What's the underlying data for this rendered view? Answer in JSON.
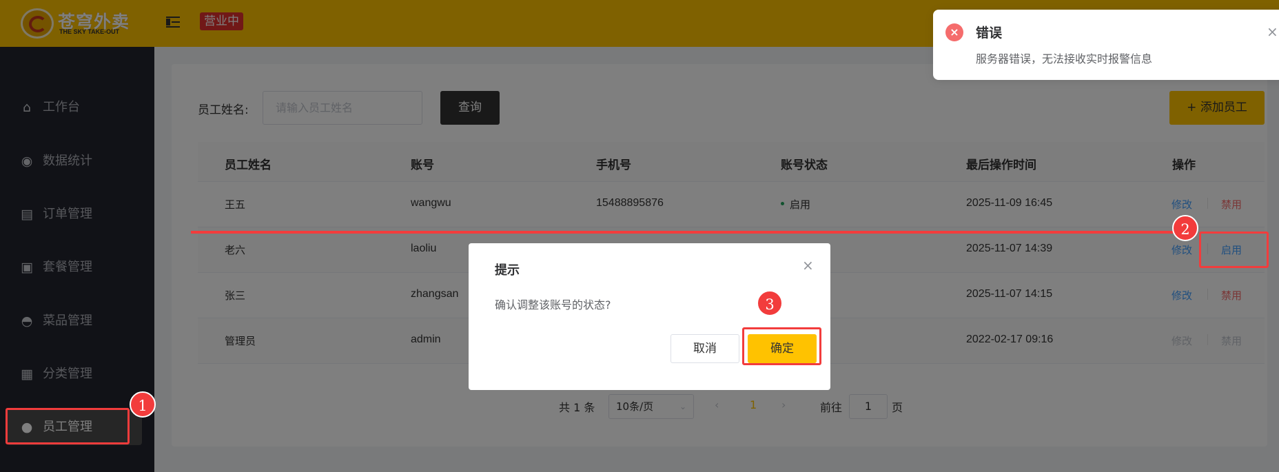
{
  "header": {
    "logo_cn": "苍穹外卖",
    "logo_en": "THE SKY TAKE-OUT",
    "status_badge": "营业中",
    "colors": {
      "brand": "#ffc200",
      "badge": "#e3302f"
    }
  },
  "sidebar": {
    "items": [
      {
        "label": "工作台",
        "icon": "home-icon"
      },
      {
        "label": "数据统计",
        "icon": "chart-icon"
      },
      {
        "label": "订单管理",
        "icon": "clipboard-icon"
      },
      {
        "label": "套餐管理",
        "icon": "gift-icon"
      },
      {
        "label": "菜品管理",
        "icon": "dish-icon"
      },
      {
        "label": "分类管理",
        "icon": "grid-icon"
      },
      {
        "label": "员工管理",
        "icon": "employee-icon",
        "active": true
      }
    ]
  },
  "search": {
    "label": "员工姓名:",
    "placeholder": "请输入员工姓名",
    "query_button": "查询",
    "add_button": "+ 添加员工"
  },
  "table": {
    "headers": [
      "员工姓名",
      "账号",
      "手机号",
      "账号状态",
      "最后操作时间",
      "操作"
    ],
    "rows": [
      {
        "name": "王五",
        "account": "wangwu",
        "phone": "15488895876",
        "status": "启用",
        "time": "2025-11-09 16:45",
        "edit": "修改",
        "toggle": "禁用"
      },
      {
        "name": "老六",
        "account": "laoliu",
        "phone": "",
        "status": "",
        "time": "2025-11-07 14:39",
        "edit": "修改",
        "toggle": "启用"
      },
      {
        "name": "张三",
        "account": "zhangsan",
        "phone": "",
        "status": "",
        "time": "2025-11-07 14:15",
        "edit": "修改",
        "toggle": "禁用"
      },
      {
        "name": "管理员",
        "account": "admin",
        "phone": "",
        "status": "",
        "time": "2022-02-17 09:16",
        "edit": "修改",
        "toggle": "禁用"
      }
    ]
  },
  "pagination": {
    "total": "共 1 条",
    "page_size": "10条/页",
    "prev": "‹",
    "current_page": "1",
    "next": "›",
    "goto_label": "前往",
    "goto_value": "1",
    "page_suffix": "页"
  },
  "notification": {
    "title": "错误",
    "message": "服务器错误，无法接收实时报警信息",
    "close": "×"
  },
  "dialog": {
    "title": "提示",
    "message": "确认调整该账号的状态?",
    "cancel": "取消",
    "confirm": "确定",
    "close": "×"
  },
  "annotations": {
    "step1": "1",
    "step2": "2",
    "step3": "3",
    "color": "#f23c3c"
  }
}
